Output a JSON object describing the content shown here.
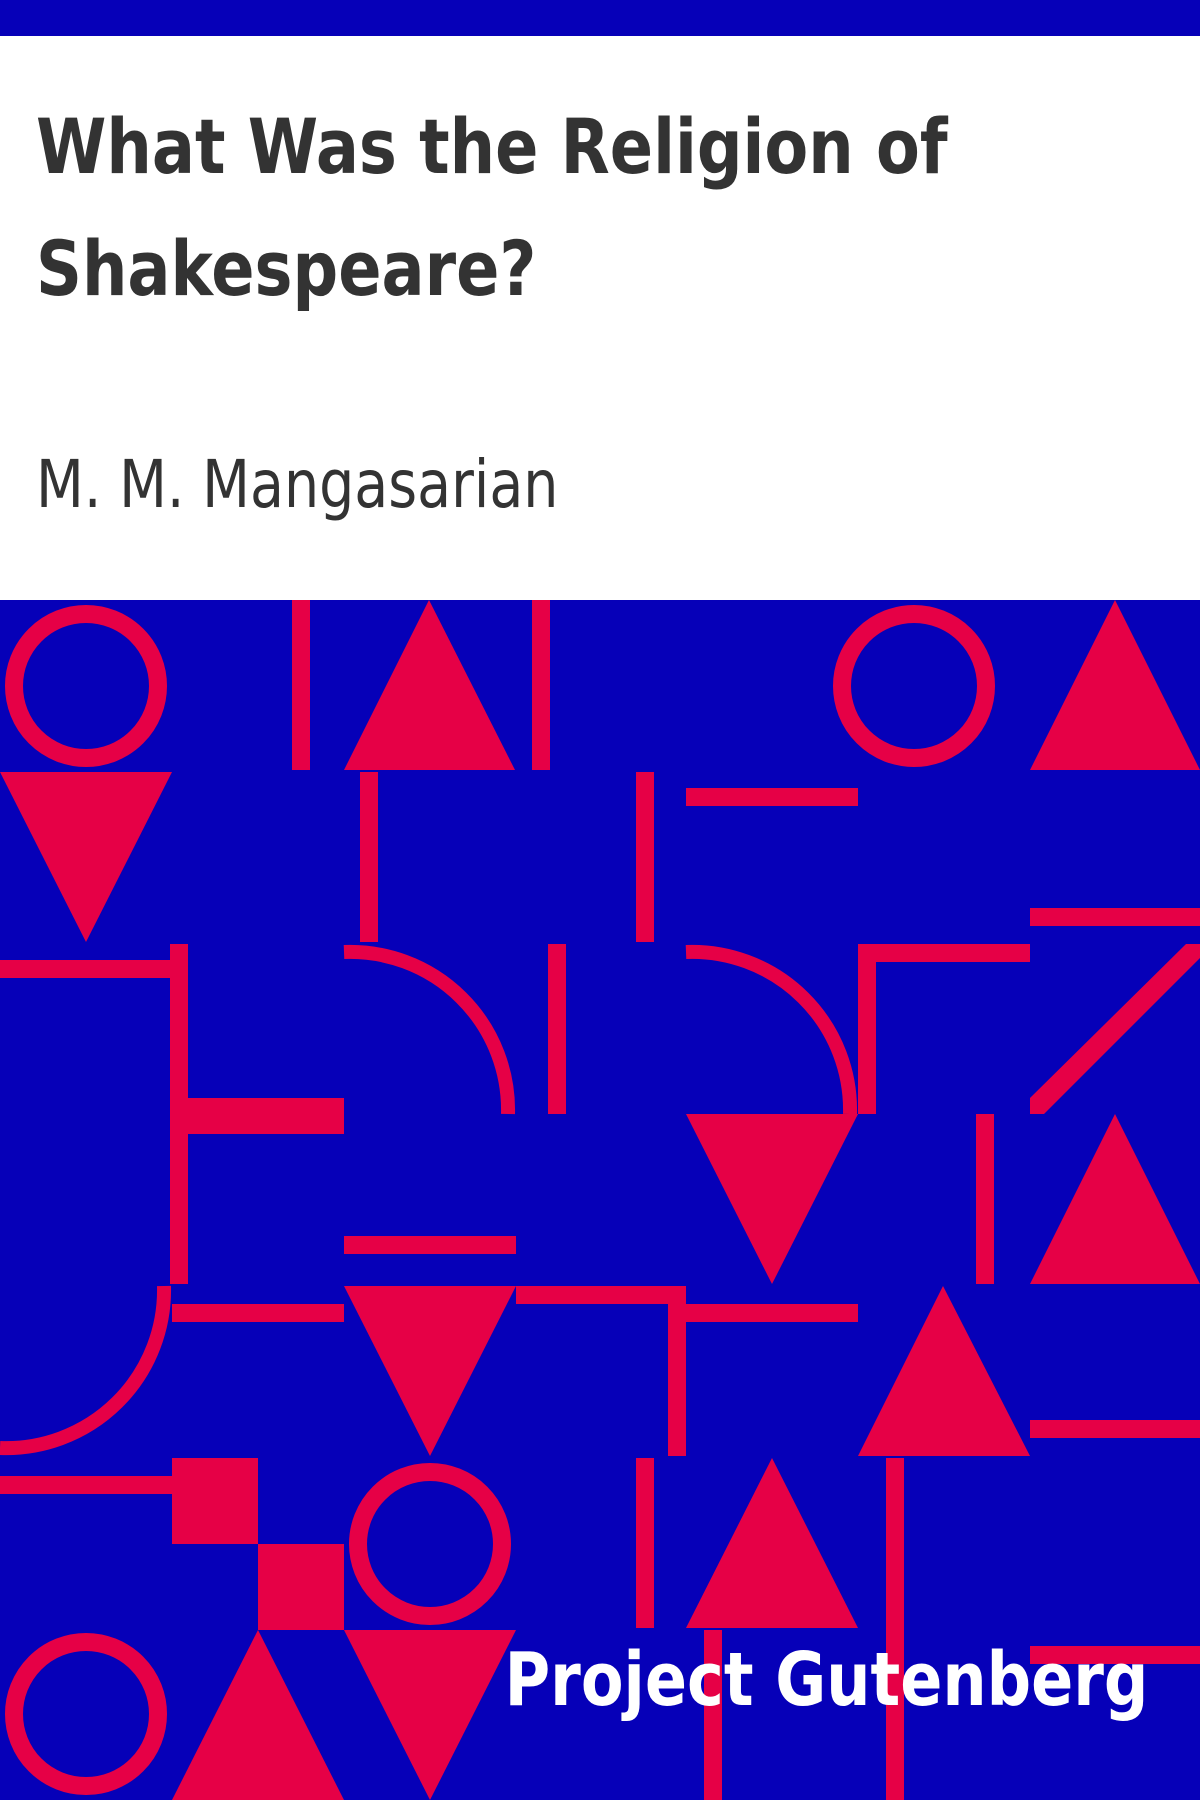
{
  "book": {
    "title": "What Was the Religion of Shakespeare?",
    "author": "M. M. Mangasarian",
    "publisher": "Project Gutenberg"
  },
  "colors": {
    "background": "#0600b8",
    "accent": "#e60046",
    "title_text": "#333333",
    "publisher_text": "#ffffff"
  }
}
